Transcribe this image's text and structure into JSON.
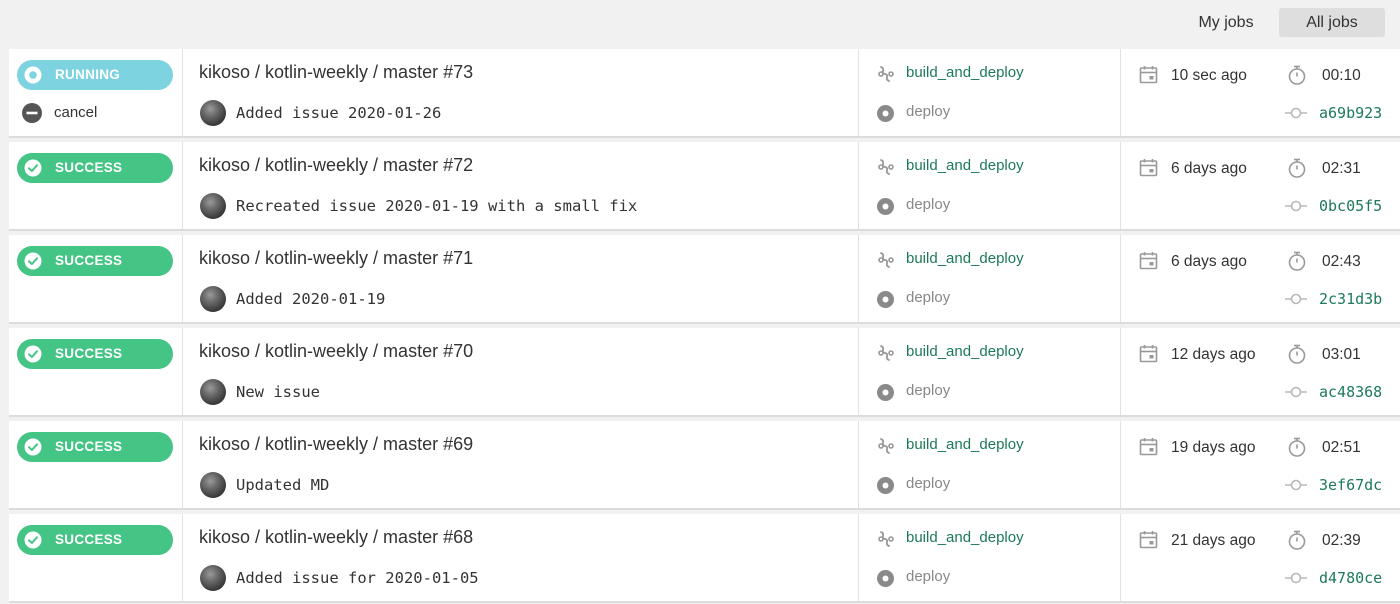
{
  "tabs": {
    "my_jobs": "My jobs",
    "all_jobs": "All jobs"
  },
  "colors": {
    "running": "#7dd3e0",
    "success": "#45c585",
    "link": "#1c7a57"
  },
  "icons": {
    "status_running": "running-icon",
    "status_success": "check-circle-icon",
    "cancel": "minus-circle-icon",
    "workflow": "workflow-icon",
    "job": "job-dot-icon",
    "date": "calendar-icon",
    "duration": "stopwatch-icon",
    "commit": "commit-icon"
  },
  "jobs": [
    {
      "status": "RUNNING",
      "cancel_label": "cancel",
      "title": "kikoso / kotlin-weekly / master #73",
      "commit_message": "Added issue 2020-01-26",
      "workflow": "build_and_deploy",
      "job": "deploy",
      "time_ago": "10 sec ago",
      "duration": "00:10",
      "commit_hash": "a69b923"
    },
    {
      "status": "SUCCESS",
      "title": "kikoso / kotlin-weekly / master #72",
      "commit_message": "Recreated issue 2020-01-19 with a small fix",
      "workflow": "build_and_deploy",
      "job": "deploy",
      "time_ago": "6 days ago",
      "duration": "02:31",
      "commit_hash": "0bc05f5"
    },
    {
      "status": "SUCCESS",
      "title": "kikoso / kotlin-weekly / master #71",
      "commit_message": "Added 2020-01-19",
      "workflow": "build_and_deploy",
      "job": "deploy",
      "time_ago": "6 days ago",
      "duration": "02:43",
      "commit_hash": "2c31d3b"
    },
    {
      "status": "SUCCESS",
      "title": "kikoso / kotlin-weekly / master #70",
      "commit_message": "New issue",
      "workflow": "build_and_deploy",
      "job": "deploy",
      "time_ago": "12 days ago",
      "duration": "03:01",
      "commit_hash": "ac48368"
    },
    {
      "status": "SUCCESS",
      "title": "kikoso / kotlin-weekly / master #69",
      "commit_message": "Updated MD",
      "workflow": "build_and_deploy",
      "job": "deploy",
      "time_ago": "19 days ago",
      "duration": "02:51",
      "commit_hash": "3ef67dc"
    },
    {
      "status": "SUCCESS",
      "title": "kikoso / kotlin-weekly / master #68",
      "commit_message": "Added issue for 2020-01-05",
      "workflow": "build_and_deploy",
      "job": "deploy",
      "time_ago": "21 days ago",
      "duration": "02:39",
      "commit_hash": "d4780ce"
    }
  ]
}
